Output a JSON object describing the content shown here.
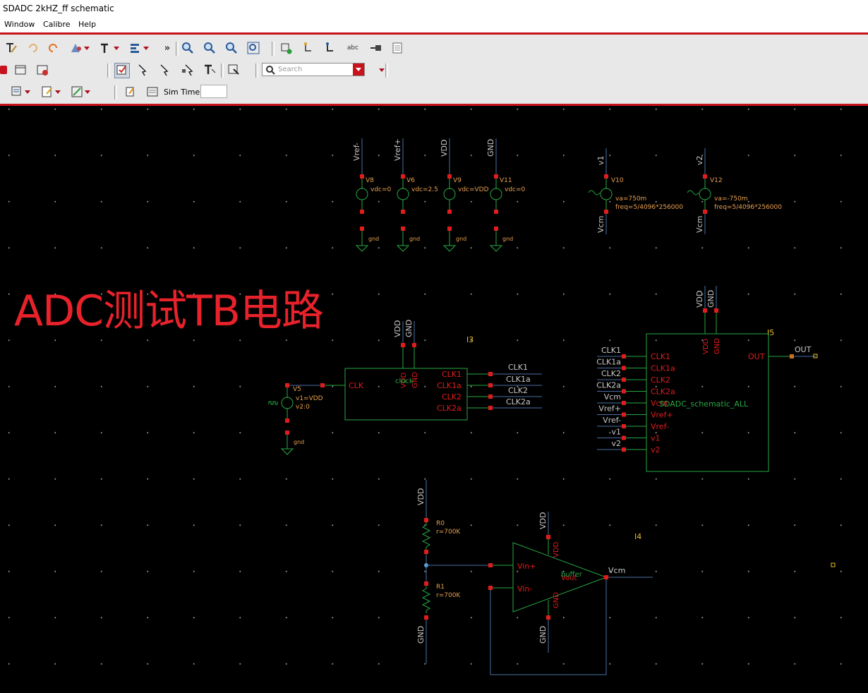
{
  "window": {
    "title": "SDADC 2kHZ_ff schematic"
  },
  "menu": [
    "Window",
    "Calibre",
    "Help"
  ],
  "toolbar": {
    "search_placeholder": "Search",
    "sim_time_label": "Sim Time",
    "icons_row1": [
      "text-tool-icon",
      "undo-icon",
      "redo-icon",
      "property-icon",
      "text-size-icon",
      "align-icon",
      "more-icon",
      "zoom-in-icon",
      "zoom-out-icon",
      "zoom-fit-icon",
      "zoom-area-icon",
      "add-instance-icon",
      "add-wire-icon",
      "add-wire-name-icon",
      "add-label-icon",
      "add-pin-icon",
      "note-icon"
    ],
    "icons_row2": [
      "stop-icon",
      "window-icon",
      "window-settings-icon",
      "select-icon",
      "select-partial-icon",
      "select-area-icon",
      "select-move-icon",
      "text-select-icon",
      "edit-icon"
    ],
    "icons_row3": [
      "netlist-icon",
      "edit-netlist-icon",
      "probe-icon",
      "simulation-icon",
      "note-list-icon"
    ]
  },
  "overlay_title": "ADC测试TB电路",
  "colors": {
    "wire": "#4a6fa5",
    "symbol": "#27a844",
    "pin": "#e21c1c",
    "label": "#c8c8c8",
    "param": "#e8a050",
    "title": "#e8222b",
    "frame": "#c8121c"
  },
  "sources": [
    {
      "net": "Vref-",
      "name": "V8",
      "param": "vdc=0",
      "ground": "gnd"
    },
    {
      "net": "Vref+",
      "name": "V6",
      "param": "vdc=2.5",
      "ground": "gnd"
    },
    {
      "net": "VDD",
      "name": "V9",
      "param": "vdc=VDD",
      "ground": "gnd"
    },
    {
      "net": "GND",
      "name": "V11",
      "param": "vdc=0",
      "ground": "gnd"
    }
  ],
  "sine_sources": [
    {
      "net": "v1",
      "name": "V10",
      "param1": "va=750m",
      "param2": "freq=5/4096*256000",
      "bottom_net": "Vcm"
    },
    {
      "net": "v2",
      "name": "V12",
      "param1": "va=-750m",
      "param2": "freq=5/4096*256000",
      "bottom_net": "Vcm"
    }
  ],
  "clock_block": {
    "instance": "I3",
    "cell": "clock",
    "supply_nets": [
      "VDD",
      "GND"
    ],
    "supply_pins": [
      "VDD",
      "GND"
    ],
    "input_pin": "CLK",
    "output_pins": [
      "CLK1",
      "CLK1a",
      "CLK2",
      "CLK2a"
    ],
    "output_nets": [
      "CLK1",
      "CLK1a",
      "CLK2",
      "CLK2a"
    ]
  },
  "pulse_source": {
    "name": "V5",
    "param1": "v1=VDD",
    "param2": "v2:0",
    "ground": "gnd"
  },
  "adc_block": {
    "instance": "I5",
    "cell": "SDADC_schematic_ALL",
    "supply_nets": [
      "VDD",
      "GND"
    ],
    "supply_pins": [
      "VDD",
      "GND"
    ],
    "input_nets": [
      "CLK1",
      "CLK1a",
      "CLK2",
      "CLK2a",
      "Vcm",
      "Vref+",
      "Vref-",
      "v1",
      "v2"
    ],
    "input_pins": [
      "CLK1",
      "CLK1a",
      "CLK2",
      "CLK2a",
      "Vcm",
      "Vref+",
      "Vref-",
      "v1",
      "v2"
    ],
    "output_pin": "OUT",
    "output_net": "OUT"
  },
  "divider": {
    "top_net": "VDD",
    "bottom_net": "GND",
    "r_top": {
      "name": "R0",
      "value": "r=700K"
    },
    "r_bottom": {
      "name": "R1",
      "value": "r=700K"
    }
  },
  "buffer": {
    "instance": "I4",
    "cell": "buffer",
    "supply_nets": [
      "VDD",
      "GND"
    ],
    "supply_pins": [
      "VDD",
      "GND"
    ],
    "inputs": [
      "Vin+",
      "Vin-"
    ],
    "output_pin": "Vout",
    "output_net": "Vcm"
  }
}
